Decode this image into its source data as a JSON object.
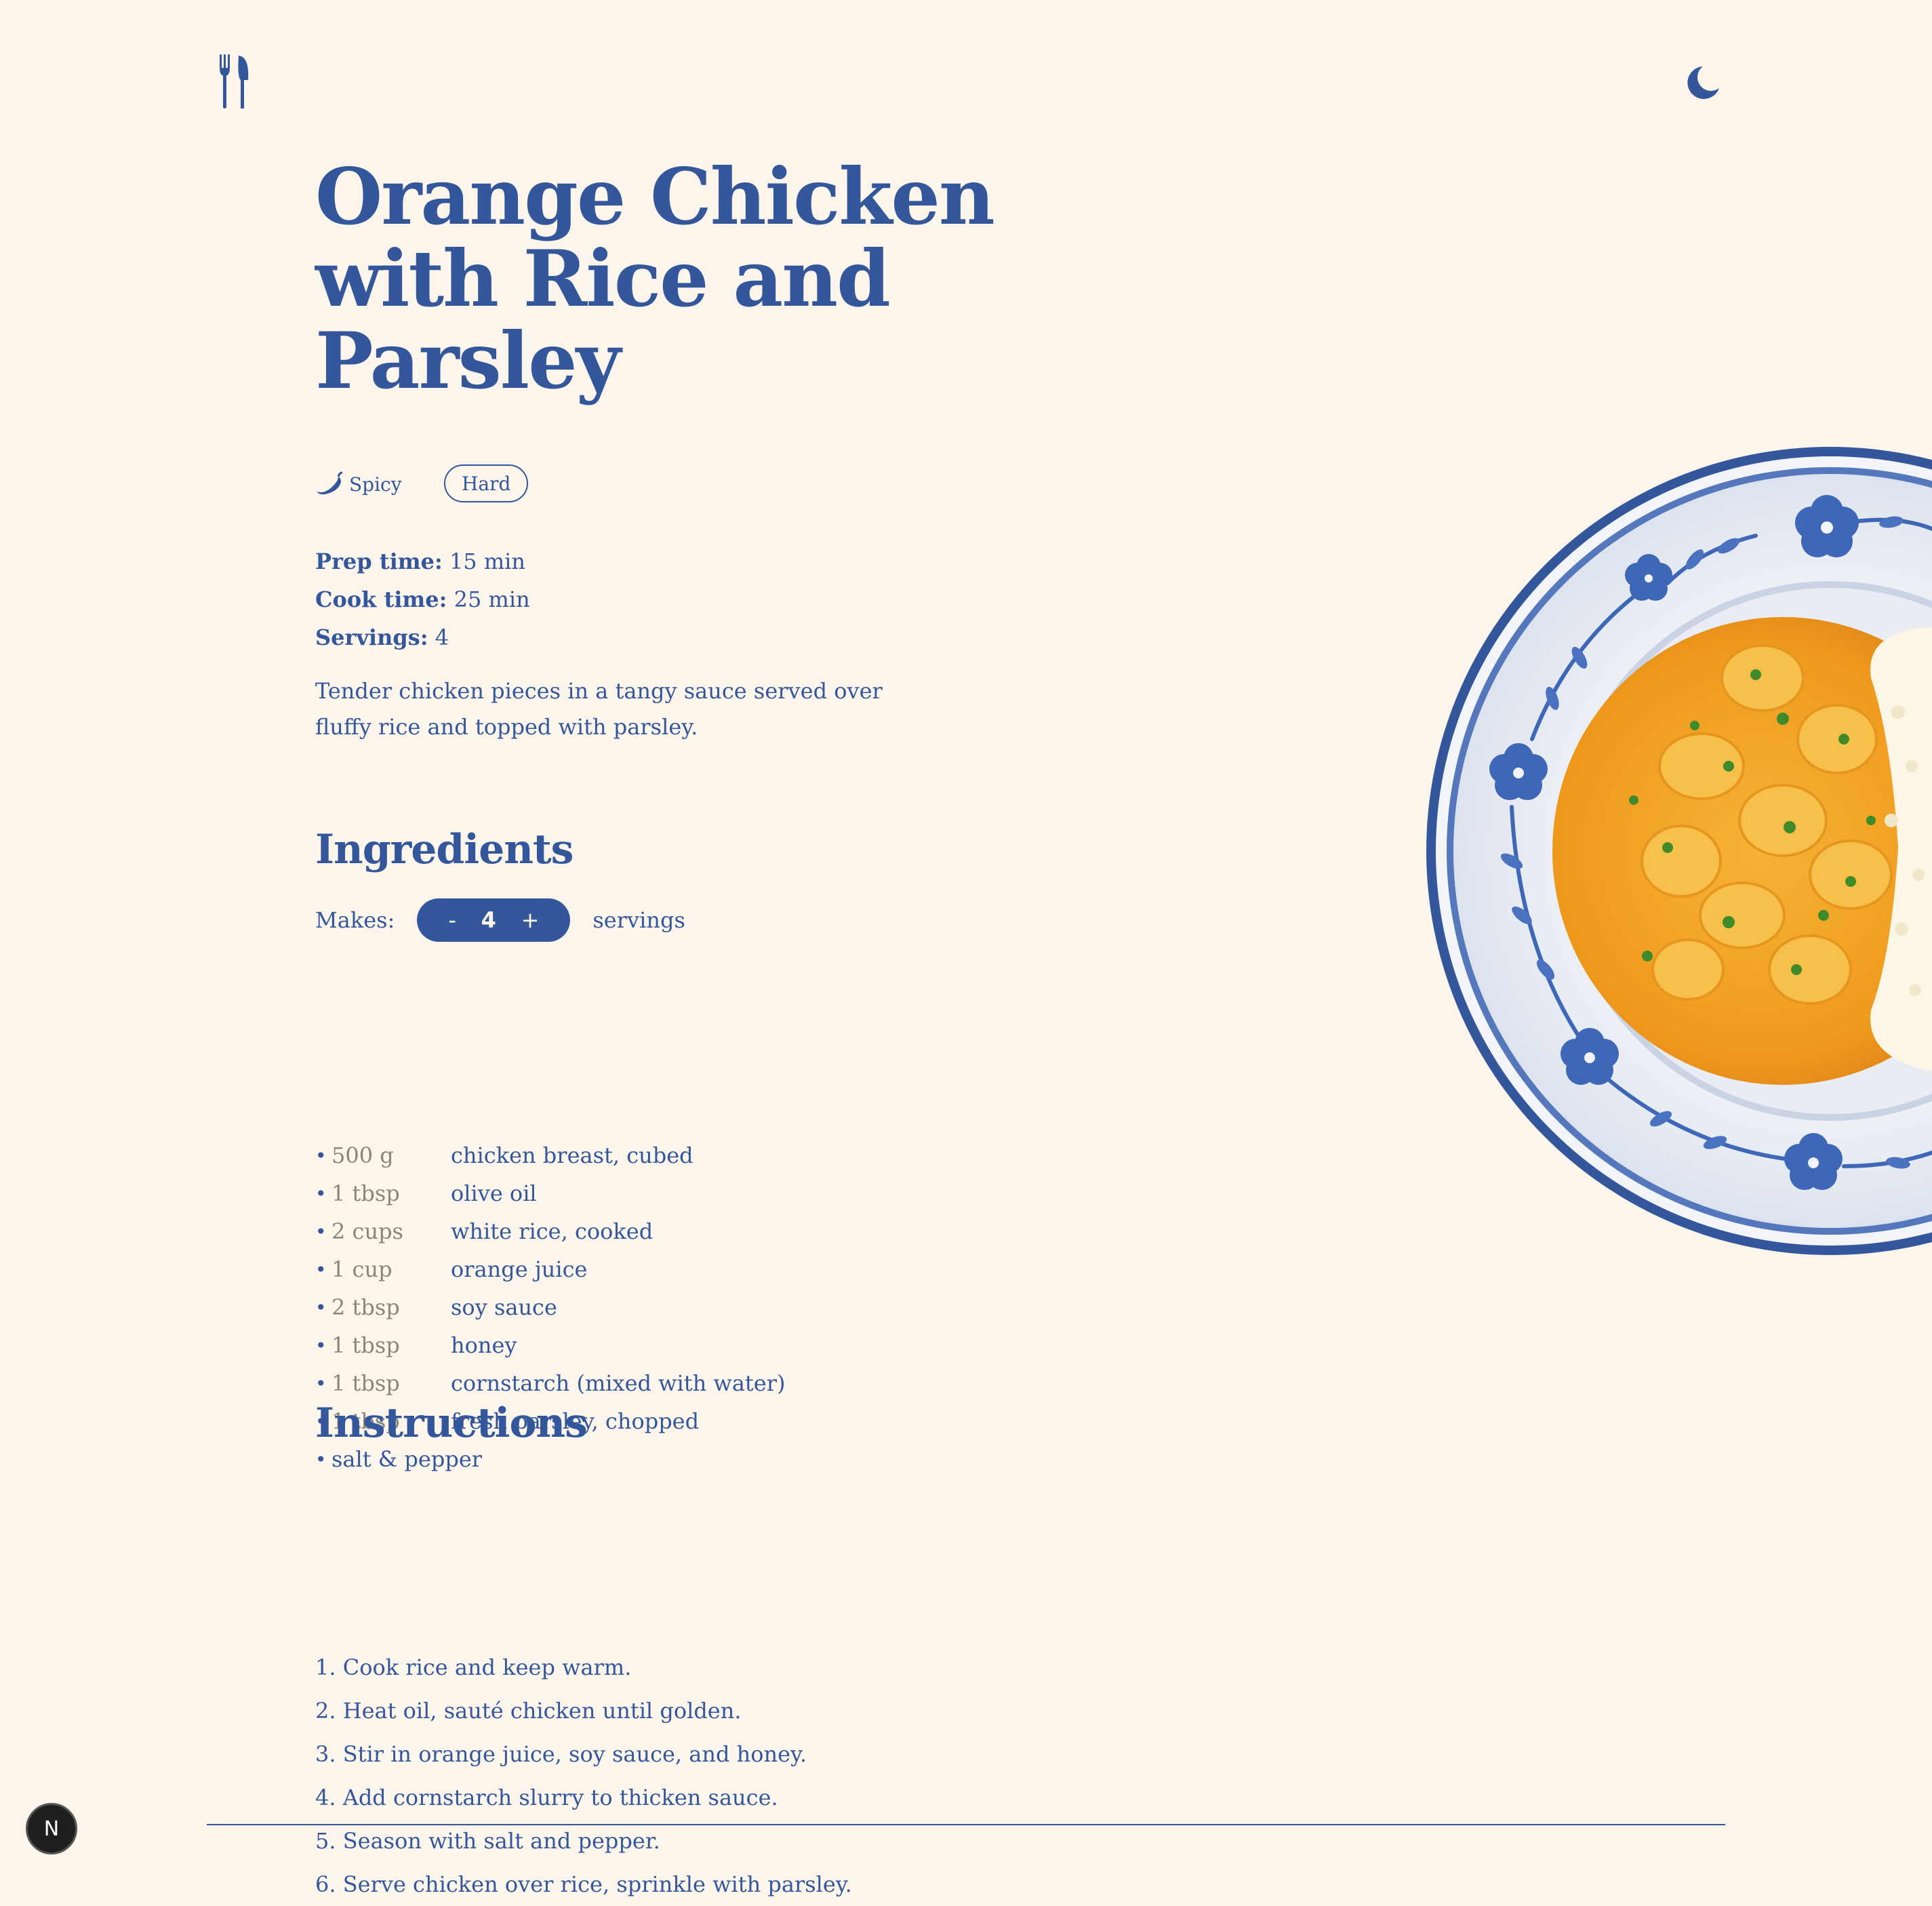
{
  "header": {
    "logo_icon": "fork-knife-icon",
    "theme_toggle_icon": "moon-icon"
  },
  "recipe": {
    "title": "Orange Chicken with Rice and Parsley",
    "spice_label": "Spicy",
    "spice_icon": "chili-icon",
    "difficulty": "Hard",
    "prep_label": "Prep time:",
    "prep_value": "15 min",
    "cook_label": "Cook time:",
    "cook_value": "25 min",
    "servings_label": "Servings:",
    "servings_value": "4",
    "description": "Tender chicken pieces in a tangy sauce served over fluffy rice and topped with parsley."
  },
  "ingredients": {
    "title": "Ingredients",
    "makes_label": "Makes:",
    "decrement": "-",
    "quantity": "4",
    "increment": "+",
    "servings_unit": "servings",
    "items": [
      {
        "amount": "500 g",
        "name": "chicken breast, cubed"
      },
      {
        "amount": "1 tbsp",
        "name": "olive oil"
      },
      {
        "amount": "2 cups",
        "name": "white rice, cooked"
      },
      {
        "amount": "1 cup",
        "name": "orange juice"
      },
      {
        "amount": "2 tbsp",
        "name": "soy sauce"
      },
      {
        "amount": "1 tbsp",
        "name": "honey"
      },
      {
        "amount": "1 tbsp",
        "name": "cornstarch (mixed with water)"
      },
      {
        "amount": "1 tbsp",
        "name": "fresh parsley, chopped"
      },
      {
        "amount": "",
        "name": "salt & pepper"
      }
    ]
  },
  "instructions": {
    "title": "Instructions",
    "steps": [
      "1. Cook rice and keep warm.",
      "2. Heat oil, sauté chicken until golden.",
      "3. Stir in orange juice, soy sauce, and honey.",
      "4. Add cornstarch slurry to thicken sauce.",
      "5. Season with salt and pepper.",
      "6. Serve chicken over rice, sprinkle with parsley."
    ]
  },
  "dev_badge": {
    "label": "N"
  },
  "colors": {
    "accent": "#34579c",
    "background": "#fbf5ec",
    "muted": "#8a8677",
    "sauce": "#f0a020"
  }
}
